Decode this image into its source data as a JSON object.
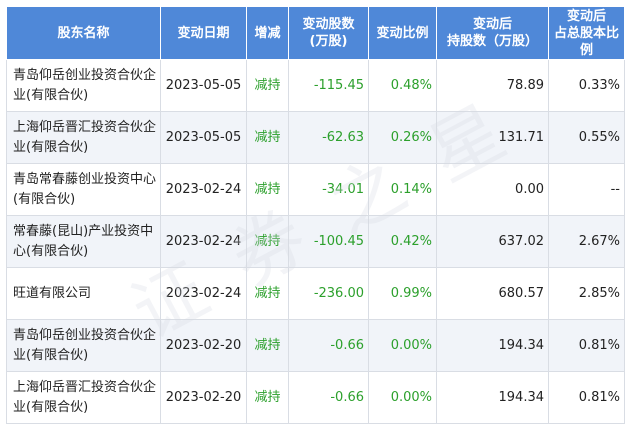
{
  "table": {
    "headers": [
      "股东名称",
      "变动日期",
      "增减",
      "变动股数\n(万股)",
      "变动比例",
      "变动后\n持股数（万股）",
      "变动后\n占总股本比例"
    ],
    "rows": [
      {
        "name": "青岛仰岳创业投资合伙企业(有限合伙)",
        "date": "2023-05-05",
        "direction": "减持",
        "change": "-115.45",
        "ratio": "0.48%",
        "after_shares": "78.89",
        "after_ratio": "0.33%"
      },
      {
        "name": "上海仰岳晋汇投资合伙企业(有限合伙)",
        "date": "2023-05-05",
        "direction": "减持",
        "change": "-62.63",
        "ratio": "0.26%",
        "after_shares": "131.71",
        "after_ratio": "0.55%"
      },
      {
        "name": "青岛常春藤创业投资中心(有限合伙)",
        "date": "2023-02-24",
        "direction": "减持",
        "change": "-34.01",
        "ratio": "0.14%",
        "after_shares": "0.00",
        "after_ratio": "--"
      },
      {
        "name": "常春藤(昆山)产业投资中心(有限合伙)",
        "date": "2023-02-24",
        "direction": "减持",
        "change": "-100.45",
        "ratio": "0.42%",
        "after_shares": "637.02",
        "after_ratio": "2.67%"
      },
      {
        "name": "旺道有限公司",
        "date": "2023-02-24",
        "direction": "减持",
        "change": "-236.00",
        "ratio": "0.99%",
        "after_shares": "680.57",
        "after_ratio": "2.85%"
      },
      {
        "name": "青岛仰岳创业投资合伙企业(有限合伙)",
        "date": "2023-02-20",
        "direction": "减持",
        "change": "-0.66",
        "ratio": "0.00%",
        "after_shares": "194.34",
        "after_ratio": "0.81%"
      },
      {
        "name": "上海仰岳晋汇投资合伙企业(有限合伙)",
        "date": "2023-02-20",
        "direction": "减持",
        "change": "-0.66",
        "ratio": "0.00%",
        "after_shares": "194.34",
        "after_ratio": "0.81%"
      }
    ]
  },
  "watermark": {
    "text": "证券之星"
  },
  "colors": {
    "header_bg": "#4f88d8",
    "decrease_green": "#2ca02c",
    "alt_row": "#f1f4f9"
  }
}
